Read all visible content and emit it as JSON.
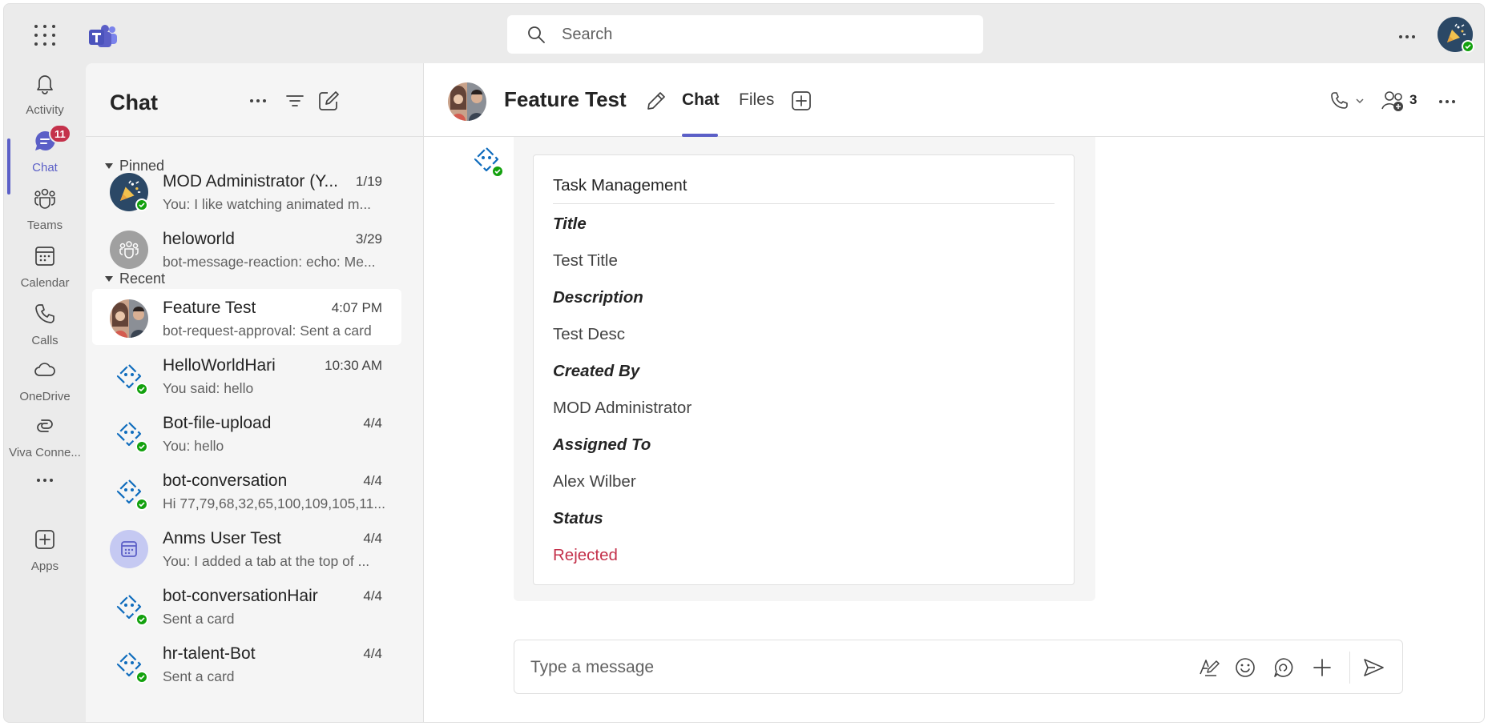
{
  "topbar": {
    "search_placeholder": "Search"
  },
  "rail": {
    "items": [
      {
        "label": "Activity",
        "icon": "bell-icon"
      },
      {
        "label": "Chat",
        "icon": "chat-icon",
        "badge": "11"
      },
      {
        "label": "Teams",
        "icon": "teams-icon"
      },
      {
        "label": "Calendar",
        "icon": "calendar-icon"
      },
      {
        "label": "Calls",
        "icon": "phone-icon"
      },
      {
        "label": "OneDrive",
        "icon": "cloud-icon"
      },
      {
        "label": "Viva Conne...",
        "icon": "viva-connections-icon"
      },
      {
        "label": "Apps",
        "icon": "add-apps-icon"
      }
    ]
  },
  "chatlist": {
    "title": "Chat",
    "pinned_label": "Pinned",
    "recent_label": "Recent",
    "pinned": [
      {
        "name": "MOD Administrator (Y...",
        "time": "1/19",
        "preview": "You: I like watching animated m..."
      },
      {
        "name": "heloworld",
        "time": "3/29",
        "preview": "bot-message-reaction: echo: Me..."
      }
    ],
    "recent": [
      {
        "name": "Feature Test",
        "time": "4:07 PM",
        "preview": "bot-request-approval: Sent a card"
      },
      {
        "name": "HelloWorldHari",
        "time": "10:30 AM",
        "preview": "You said: hello"
      },
      {
        "name": "Bot-file-upload",
        "time": "4/4",
        "preview": "You: hello"
      },
      {
        "name": "bot-conversation",
        "time": "4/4",
        "preview": "Hi 77,79,68,32,65,100,109,105,11..."
      },
      {
        "name": "Anms User Test",
        "time": "4/4",
        "preview": "You: I added a tab at the top of ..."
      },
      {
        "name": "bot-conversationHair",
        "time": "4/4",
        "preview": "Sent a card"
      },
      {
        "name": "hr-talent-Bot",
        "time": "4/4",
        "preview": "Sent a card"
      }
    ]
  },
  "main": {
    "title": "Feature Test",
    "tabs": [
      {
        "label": "Chat",
        "active": true
      },
      {
        "label": "Files",
        "active": false
      }
    ],
    "participants_count": "3",
    "card": {
      "title": "Task Management",
      "fields": [
        {
          "label": "Title",
          "value": "Test Title"
        },
        {
          "label": "Description",
          "value": "Test Desc"
        },
        {
          "label": "Created By",
          "value": "MOD Administrator"
        },
        {
          "label": "Assigned To",
          "value": "Alex Wilber"
        },
        {
          "label": "Status",
          "value": "Rejected"
        }
      ]
    },
    "composer_placeholder": "Type a message"
  },
  "colors": {
    "accent": "#5b5fc7",
    "badge": "#c4314b",
    "presence_available": "#13a10e",
    "rejected": "#c4314b",
    "bot_icon": "#0f6cbd"
  }
}
